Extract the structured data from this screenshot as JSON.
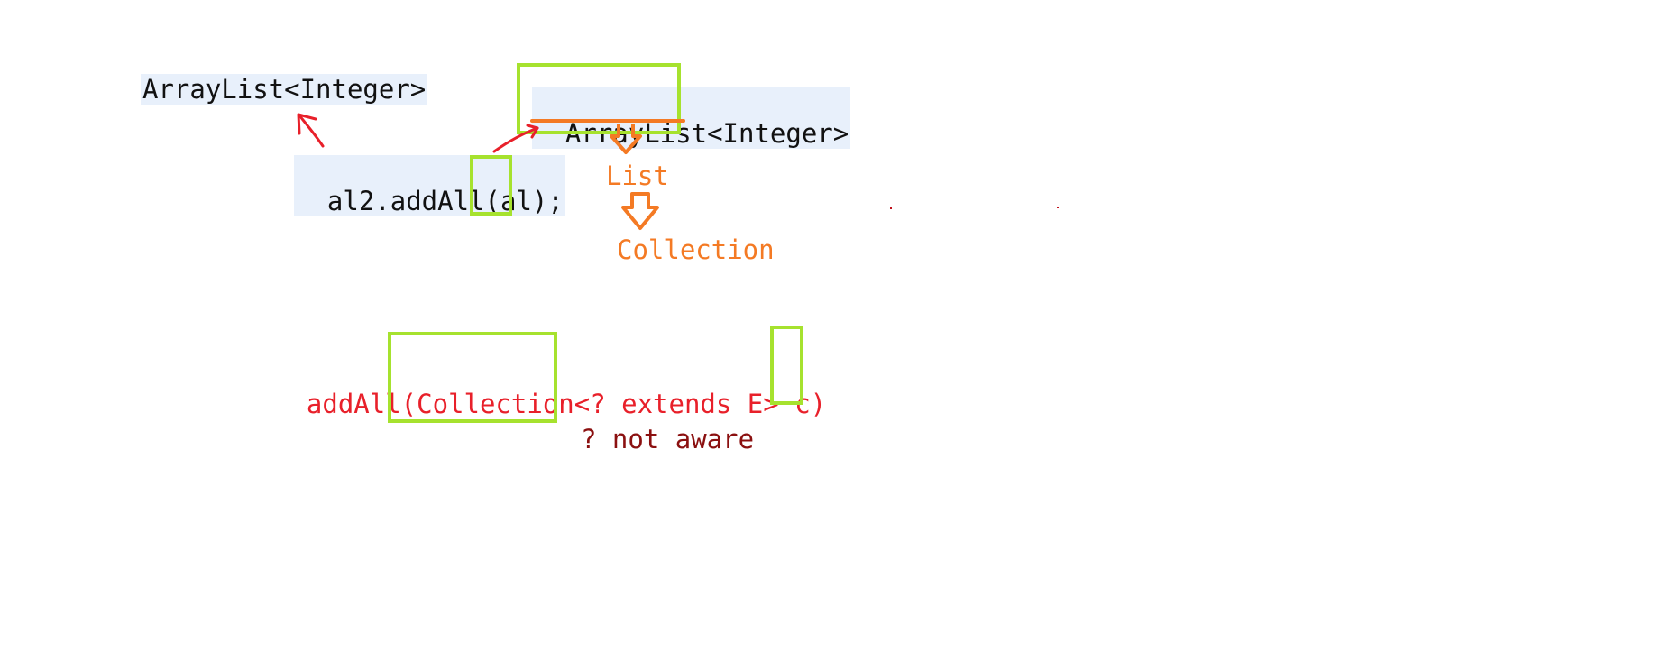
{
  "code": {
    "left_type": "ArrayList<Integer>",
    "call_prefix": "al2.addAll(",
    "call_arg": "al",
    "call_suffix": ");",
    "right_type_name": "ArrayList",
    "right_type_generic": "<Integer>"
  },
  "hierarchy": {
    "level1": "List",
    "level2": "Collection"
  },
  "signature": {
    "prefix": "addAll(",
    "param_type": "Collection",
    "generic": "<? extends E> ",
    "param_name": "c",
    "suffix": ")"
  },
  "note": "? not aware",
  "colors": {
    "highlight_box": "#a6e22e",
    "annotation_orange": "#f47a24",
    "annotation_red": "#e8202a",
    "note_darkred": "#8b1010",
    "code_background": "#e8f0fb"
  }
}
